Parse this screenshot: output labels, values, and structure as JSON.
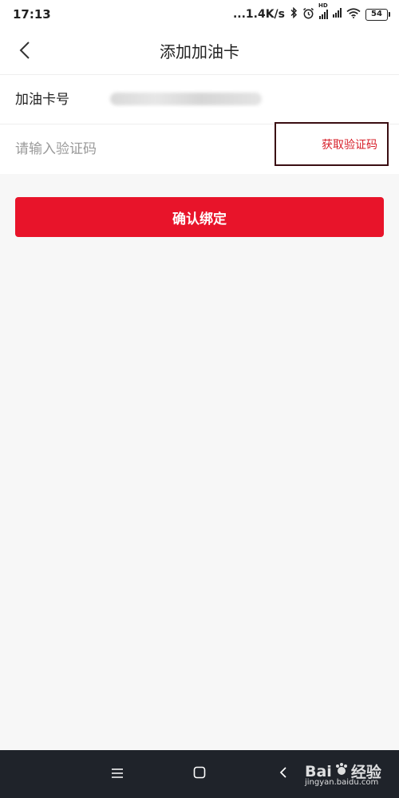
{
  "status_bar": {
    "time": "17:13",
    "network_speed": "...1.4K/s",
    "network_badge": "HD",
    "battery": "54",
    "icons": [
      "bluetooth-icon",
      "alarm-icon",
      "signal-icon",
      "signal-icon",
      "wifi-icon",
      "battery-icon"
    ]
  },
  "header": {
    "title": "添加加油卡",
    "back_icon": "chevron-left-icon"
  },
  "form": {
    "card_number_label": "加油卡号",
    "card_number_value": "9100271000000067091",
    "code_placeholder": "请输入验证码",
    "code_value": "",
    "get_code_label": "获取验证码"
  },
  "actions": {
    "confirm_label": "确认绑定"
  },
  "nav_bar": {
    "icons": [
      "menu-icon",
      "home-square-icon",
      "back-chevron-icon"
    ]
  },
  "watermark": {
    "brand": "Bai",
    "brand_suffix": "经验",
    "sub": "jingyan.baidu.com"
  },
  "colors": {
    "accent": "#e8142a",
    "link": "#d7202a",
    "highlight_border": "#3a0d12",
    "background": "#f7f7f7",
    "nav_background": "#1f232a"
  }
}
